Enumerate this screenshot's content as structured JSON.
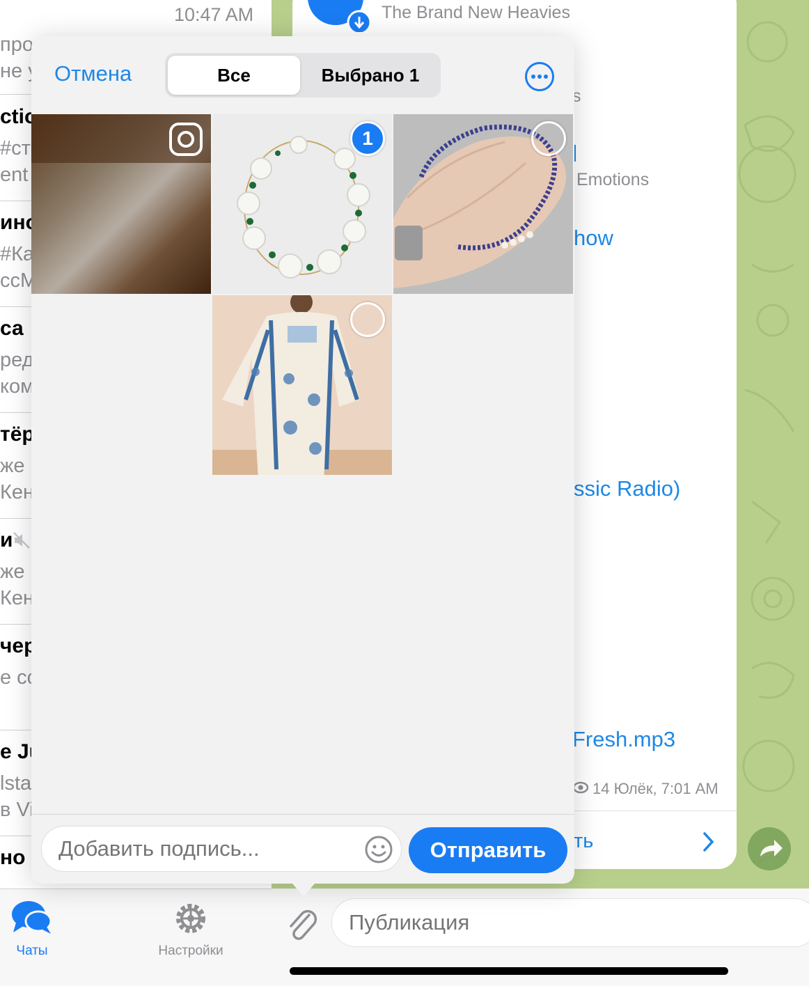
{
  "chat_list": {
    "time": "10:47 AM",
    "rows": [
      {
        "t1": "",
        "t2": "про",
        "t3": "не у"
      },
      {
        "t1": "ctio",
        "t2": "#ста",
        "t3": "ent"
      },
      {
        "t1": "ино",
        "t2": "#Ка",
        "t3": "ссМ"
      },
      {
        "t1": " са",
        "t2": "ред",
        "t3": "ком"
      },
      {
        "t1": "тёр",
        "t2": " же",
        "t3": "Кени"
      },
      {
        "t1": "и",
        "t2": " же",
        "t3": "Кени"
      },
      {
        "t1": "чер",
        "t2": "е сс",
        "t3": ""
      },
      {
        "t1": "e Ju",
        "t2": "lsta",
        "t3": "в Vi"
      },
      {
        "t1": "но |",
        "t2": "",
        "t3": ""
      }
    ]
  },
  "tabs": {
    "chats": "Чаты",
    "settings": "Настройки"
  },
  "chat_bubble": {
    "audio_title": "The Brand New Heavies",
    "line_s": "s",
    "line_emotions": "Emotions",
    "line_show": "how",
    "line_radio": "ssic Radio)",
    "line_mp3": "Fresh.mp3",
    "meta": "14 Юлёк, 7:01 AM",
    "action": "ть"
  },
  "input_bar": {
    "placeholder": "Публикация"
  },
  "picker": {
    "cancel": "Отмена",
    "seg_all": "Все",
    "seg_selected": "Выбрано 1",
    "selected_badge": "1",
    "caption_placeholder": "Добавить подпись...",
    "send": "Отправить"
  },
  "colors": {
    "accent": "#1a7cf3",
    "link": "#1e88e5",
    "chat_bg": "#b8cf8c"
  },
  "icons": [
    "camera-icon",
    "more-icon",
    "emoji-icon",
    "paperclip-icon",
    "chats-icon",
    "settings-gear-icon",
    "share-icon",
    "chevron-right-icon",
    "eye-icon",
    "download-icon",
    "mute-icon"
  ]
}
